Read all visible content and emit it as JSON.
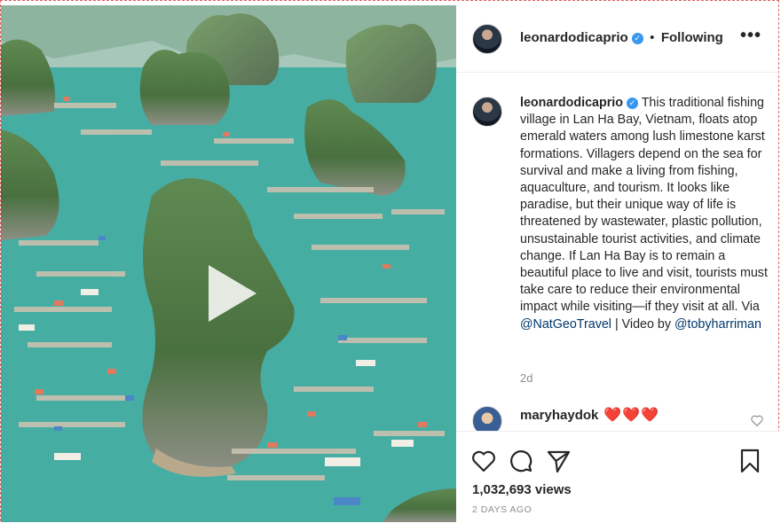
{
  "post": {
    "author": "leonardodicaprio",
    "verified_mark": "✓",
    "separator": "•",
    "follow_status": "Following",
    "more_options": "•••",
    "caption": {
      "text_1": "This traditional fishing village in Lan Ha Bay, Vietnam, floats atop emerald waters among lush limestone karst formations. Villagers depend on the sea for survival and make a living from fishing, aquaculture, and tourism. It looks like paradise, but their unique way of life is threatened by wastewater, plastic pollution, unsustainable tourist activities, and climate change. If Lan Ha Bay is to remain a beautiful place to live and visit, tourists must take care to reduce their environmental impact while visiting—if they visit at all. Via ",
      "mention_1": "@NatGeoTravel",
      "text_2": " | Video by ",
      "mention_2": "@tobyharriman"
    },
    "age": "2d",
    "comment": {
      "user": "maryhaydok",
      "text": "❤️❤️❤️"
    },
    "views": "1,032,693 views",
    "posted": "2 DAYS AGO"
  },
  "icons": {
    "like": "heart-outline-icon",
    "comment": "speech-bubble-icon",
    "share": "paper-plane-icon",
    "save": "bookmark-icon",
    "play": "play-icon",
    "comment_like": "small-heart-icon"
  },
  "colors": {
    "link": "#00376b",
    "verified": "#3897f0",
    "muted": "#8e8e8e",
    "heart": "#ed4956"
  }
}
